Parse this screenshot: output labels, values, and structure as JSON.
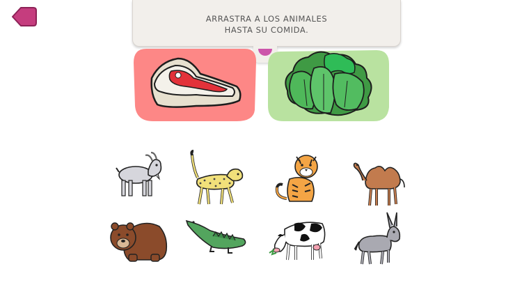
{
  "instruction": {
    "line1": "ARRASTRA A LOS ANIMALES",
    "line2": "HASTA SU COMIDA."
  },
  "colors": {
    "back_button": "#c53d7e",
    "meat_box": "#fd8786",
    "leaf_box": "#b9e2a0",
    "panel": "#f2efeb",
    "tab_dot": "#cc55aa"
  },
  "food_targets": [
    {
      "name": "meat",
      "icon": "steak-icon"
    },
    {
      "name": "vegetables",
      "icon": "lettuce-icon"
    }
  ],
  "animals": [
    {
      "name": "goat",
      "icon": "goat-icon"
    },
    {
      "name": "cheetah",
      "icon": "cheetah-icon"
    },
    {
      "name": "tiger",
      "icon": "tiger-icon"
    },
    {
      "name": "camel",
      "icon": "camel-icon"
    },
    {
      "name": "bear",
      "icon": "bear-icon"
    },
    {
      "name": "crocodile",
      "icon": "crocodile-icon"
    },
    {
      "name": "cow",
      "icon": "cow-icon"
    },
    {
      "name": "donkey",
      "icon": "donkey-icon"
    }
  ]
}
